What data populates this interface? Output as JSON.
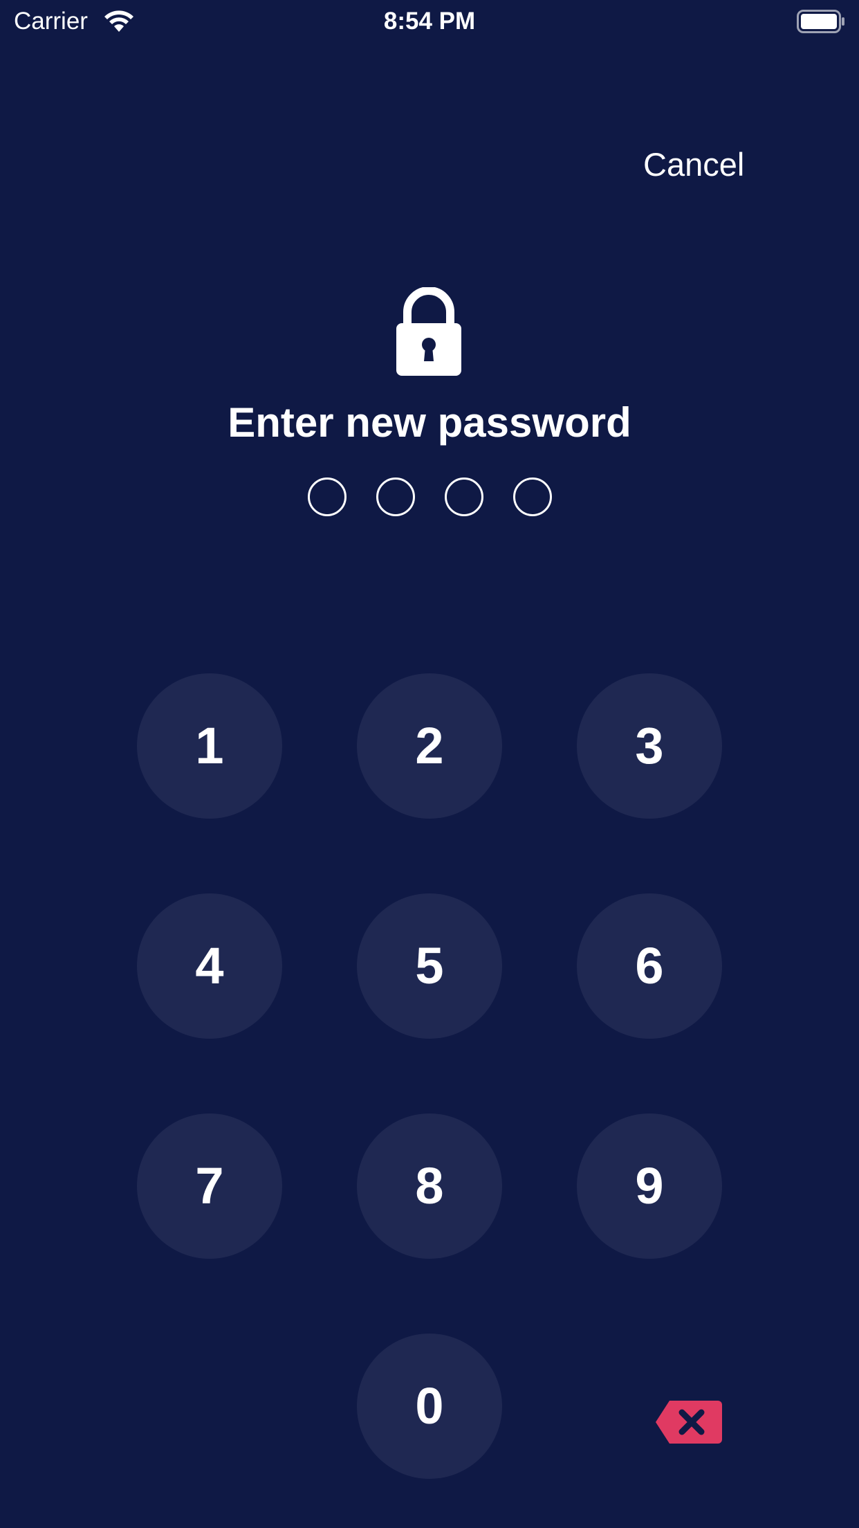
{
  "status_bar": {
    "carrier": "Carrier",
    "time": "8:54 PM",
    "wifi_icon": "wifi-icon",
    "battery_icon": "battery-icon"
  },
  "header": {
    "cancel_label": "Cancel"
  },
  "main": {
    "lock_icon": "lock-icon",
    "prompt": "Enter new password",
    "passcode_length": 4,
    "entered_digits": 0
  },
  "keypad": {
    "keys": [
      "1",
      "2",
      "3",
      "4",
      "5",
      "6",
      "7",
      "8",
      "9",
      "0"
    ],
    "backspace_icon": "backspace-icon"
  },
  "colors": {
    "background": "#0f1945",
    "key_background": "#1f2852",
    "text": "#ffffff",
    "backspace": "#e03a62"
  }
}
